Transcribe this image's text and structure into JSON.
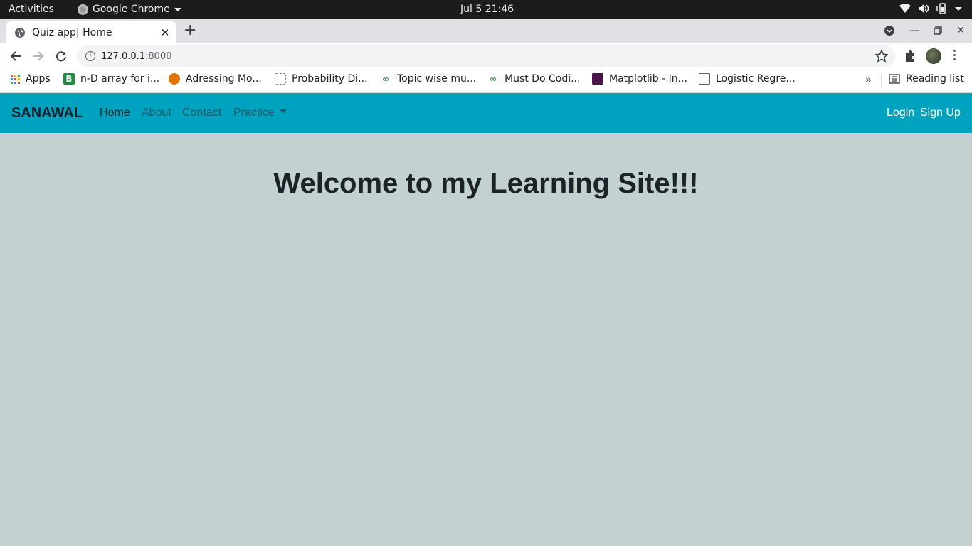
{
  "os": {
    "activities": "Activities",
    "app_name": "Google Chrome",
    "clock": "Jul 5  21:46"
  },
  "browser": {
    "tab_title": "Quiz app| Home",
    "url_host": "127.0.0.1",
    "url_port": ":8000",
    "bookmarks": [
      {
        "label": "Apps",
        "icon": "apps-grid-icon"
      },
      {
        "label": "n-D array for i...",
        "icon": "b-icon",
        "color": "#1e8e3e"
      },
      {
        "label": "Adressing Mo...",
        "icon": "tutorial-icon",
        "color": "#e37400"
      },
      {
        "label": "Probability Di...",
        "icon": "dice-icon",
        "color": "#80868b"
      },
      {
        "label": "Topic wise mu...",
        "icon": "gfg-icon",
        "color": "#2f8d46"
      },
      {
        "label": "Must Do Codi...",
        "icon": "gfg-icon",
        "color": "#2f8d46"
      },
      {
        "label": "Matplotlib - In...",
        "icon": "ml-icon",
        "color": "#4a154b"
      },
      {
        "label": "Logistic Regre...",
        "icon": "building-icon",
        "color": "#5f6368"
      }
    ],
    "reading_list": "Reading list"
  },
  "site": {
    "brand": "SANAWAL",
    "nav": {
      "home": "Home",
      "about": "About",
      "contact": "Contact",
      "practice": "Practice"
    },
    "login": "Login",
    "signup": "Sign Up",
    "heading": "Welcome to my Learning Site!!!",
    "colors": {
      "navbar": "#00a3bf",
      "background": "#c3d1d1"
    }
  }
}
